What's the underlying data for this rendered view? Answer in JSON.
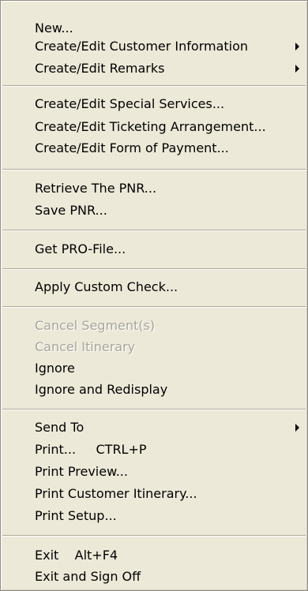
{
  "menu": {
    "items": [
      {
        "label": "New..."
      },
      {
        "label": "Create/Edit Customer Information"
      },
      {
        "label": "Create/Edit Remarks"
      },
      {
        "label": "Create/Edit Special Services..."
      },
      {
        "label": "Create/Edit Ticketing Arrangement..."
      },
      {
        "label": "Create/Edit Form of Payment..."
      },
      {
        "label": "Retrieve The PNR..."
      },
      {
        "label": "Save PNR..."
      },
      {
        "label": "Get PRO-File..."
      },
      {
        "label": "Apply Custom Check..."
      },
      {
        "label": "Cancel Segment(s)"
      },
      {
        "label": "Cancel Itinerary"
      },
      {
        "label": "Ignore"
      },
      {
        "label": "Ignore and Redisplay"
      },
      {
        "label": "Send To"
      },
      {
        "label": "Print...     CTRL+P"
      },
      {
        "label": "Print Preview..."
      },
      {
        "label": "Print Customer Itinerary..."
      },
      {
        "label": "Print Setup..."
      },
      {
        "label": "Exit    Alt+F4"
      },
      {
        "label": "Exit and Sign Off"
      }
    ]
  }
}
